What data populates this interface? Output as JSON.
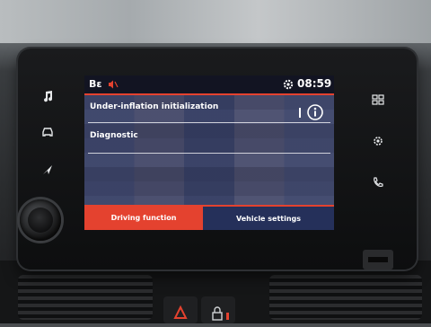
{
  "status_bar": {
    "bluetooth_label": "Bε",
    "mute_icon": "speaker-muted-icon",
    "settings_icon": "gear-icon",
    "time": "08:59"
  },
  "menu": {
    "items": [
      {
        "label": "Under-inflation initialization",
        "has_info": true
      },
      {
        "label": "Diagnostic"
      }
    ]
  },
  "tabs": [
    {
      "label": "Driving function",
      "active": true
    },
    {
      "label": "Vehicle settings",
      "active": false
    }
  ],
  "side_buttons": {
    "left": [
      "music-note-icon",
      "car-icon",
      "navigation-arrow-icon"
    ],
    "right": [
      "apps-grid-icon",
      "gear-icon",
      "phone-icon"
    ]
  },
  "colors": {
    "accent": "#e4422f",
    "screen_bg": "#1c2033",
    "tab_inactive": "#25305a"
  }
}
